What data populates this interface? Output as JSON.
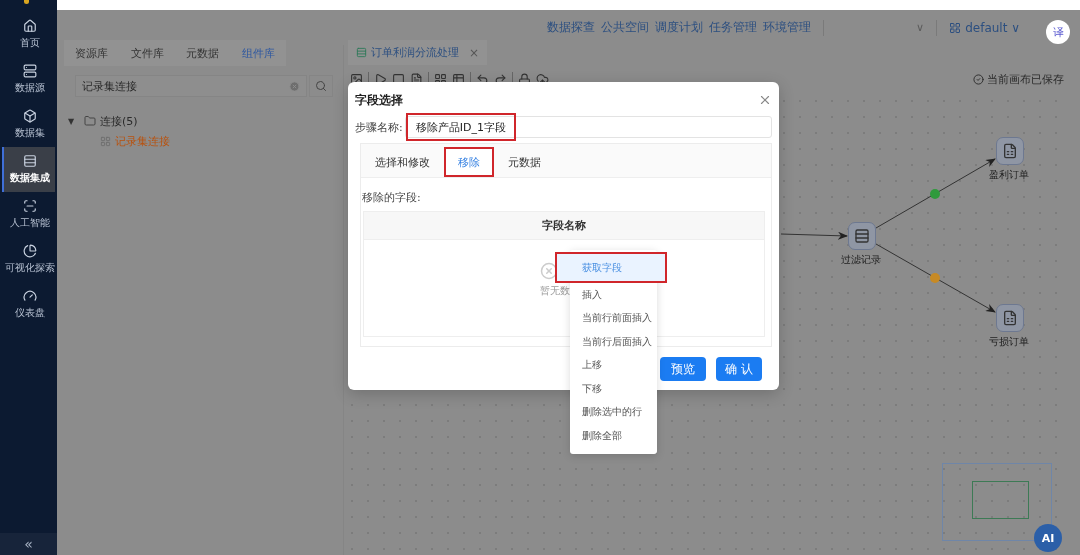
{
  "sidebar": {
    "items": [
      {
        "label": "首页",
        "selected": false
      },
      {
        "label": "数据源",
        "selected": false
      },
      {
        "label": "数据集",
        "selected": false
      },
      {
        "label": "数据集成",
        "selected": true
      },
      {
        "label": "人工智能",
        "selected": false
      },
      {
        "label": "可视化探索",
        "selected": false
      },
      {
        "label": "仪表盘",
        "selected": false
      }
    ],
    "collapse": "«"
  },
  "top_nav": {
    "items": [
      "数据探查",
      "公共空间",
      "调度计划",
      "任务管理",
      "环境管理"
    ],
    "dropdown": "∨",
    "workspace": "default ∨",
    "translate": "译"
  },
  "left_panel": {
    "tabs": [
      {
        "label": "资源库",
        "selected": false
      },
      {
        "label": "文件库",
        "selected": false
      },
      {
        "label": "元数据",
        "selected": false
      },
      {
        "label": "组件库",
        "selected": true
      }
    ],
    "search": {
      "value": "记录集连接"
    },
    "tree": [
      {
        "label": "连接(5)",
        "toggle": "▼",
        "expanded": true,
        "children": [
          {
            "label": "记录集连接",
            "highlighted": true
          }
        ]
      }
    ]
  },
  "canvas": {
    "tab": {
      "title": "订单利润分流处理",
      "close": "×"
    },
    "status": "当前画布已保存",
    "nodes": [
      {
        "label": "过滤记录",
        "kind": "filter"
      },
      {
        "label": "盈利订单",
        "kind": "excel"
      },
      {
        "label": "亏损订单",
        "kind": "excel"
      }
    ],
    "edges": [
      {
        "kind": "input"
      },
      {
        "kind": "success"
      },
      {
        "kind": "failure"
      }
    ]
  },
  "dialog": {
    "title": "字段选择",
    "step_name": {
      "label": "步骤名称:",
      "value": "移除产品ID_1字段",
      "highlighted": true
    },
    "tabs": [
      {
        "label": "选择和修改",
        "selected": false,
        "highlighted": false
      },
      {
        "label": "移除",
        "selected": true,
        "highlighted": true
      },
      {
        "label": "元数据",
        "selected": false,
        "highlighted": false
      }
    ],
    "section_label": "移除的字段:",
    "table": {
      "columns": [
        "字段名称"
      ],
      "empty_text": "暂无数"
    },
    "buttons": [
      "预览",
      "确 认"
    ]
  },
  "context_menu": {
    "items": [
      {
        "label": "获取字段",
        "selected": true,
        "highlighted": true
      },
      {
        "label": "插入",
        "selected": false,
        "highlighted": false
      },
      {
        "label": "当前行前面插入",
        "selected": false,
        "highlighted": false
      },
      {
        "label": "当前行后面插入",
        "selected": false,
        "highlighted": false
      },
      {
        "label": "上移",
        "selected": false,
        "highlighted": false
      },
      {
        "label": "下移",
        "selected": false,
        "highlighted": false
      },
      {
        "label": "删除选中的行",
        "selected": false,
        "highlighted": false
      },
      {
        "label": "删除全部",
        "selected": false,
        "highlighted": false
      }
    ]
  },
  "ai_button": "AI"
}
